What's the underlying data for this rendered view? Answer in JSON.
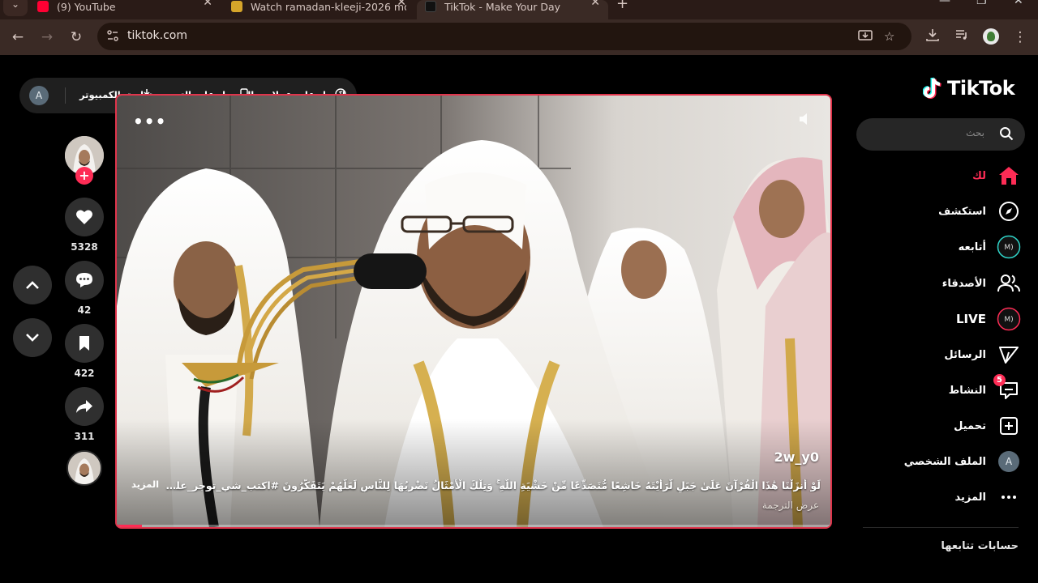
{
  "browser": {
    "tabs": [
      {
        "title": "(9) YouTube",
        "favicon_color": "#ff0033",
        "active": false
      },
      {
        "title": "Watch ramadan-kleeji-2026 mo",
        "favicon_color": "#d6a52a",
        "active": false
      },
      {
        "title": "TikTok - Make Your Day",
        "favicon_color": "#111111",
        "active": true
      }
    ],
    "new_tab_symbol": "+",
    "url": "tiktok.com"
  },
  "top_bar": {
    "avatar_letter": "A",
    "coins_label": "احصل على عملات",
    "get_app_label": "الحصول على التـ...",
    "desktop_app_label": "تطبيق الكمبيوتر"
  },
  "video": {
    "username": "2w_y0",
    "caption": "لَوْ أَنزَلْنَا هَٰذَا الْقُرْآنَ عَلَىٰ جَبَلٍ لَّرَأَيْتَهُ خَاشِعًا مُّتَصَدِّعًا مِّنْ خَشْيَةِ اللَّهِ ۚ وَتِلْكَ الْأَمْثَالُ نَضْرِبُهَا لِلنَّاسِ لَعَلَّهُمْ يَتَفَكَّرُونَ #اكتب_شي_توجر_عليه #قران_كري...",
    "more_label": "المزيد",
    "translate_label": "عرض الترجمة",
    "progress": 0.035
  },
  "actions": {
    "likes": "5328",
    "comments": "42",
    "saves": "422",
    "shares": "311"
  },
  "sidebar": {
    "logo_text": "TikTok",
    "search_placeholder": "بحث",
    "items": [
      {
        "label": "لك",
        "icon": "home-icon"
      },
      {
        "label": "استكشف",
        "icon": "compass-icon"
      },
      {
        "label": "أتابعه",
        "icon": "following-avatar-icon"
      },
      {
        "label": "الأصدقاء",
        "icon": "friends-icon"
      },
      {
        "label": "LIVE",
        "icon": "live-avatar-icon"
      },
      {
        "label": "الرسائل",
        "icon": "send-icon"
      },
      {
        "label": "النشاط",
        "icon": "activity-icon",
        "badge": "5"
      },
      {
        "label": "تحميل",
        "icon": "upload-icon"
      },
      {
        "label": "الملف الشخصي",
        "icon": "profile-avatar-icon",
        "avatar_letter": "A"
      },
      {
        "label": "المزيد",
        "icon": "more-icon"
      }
    ],
    "following_header": "حسابات تتابعها"
  },
  "colors": {
    "accent": "#fe2c55",
    "chrome_bg": "#3a2a25",
    "page_bg": "#000000"
  }
}
